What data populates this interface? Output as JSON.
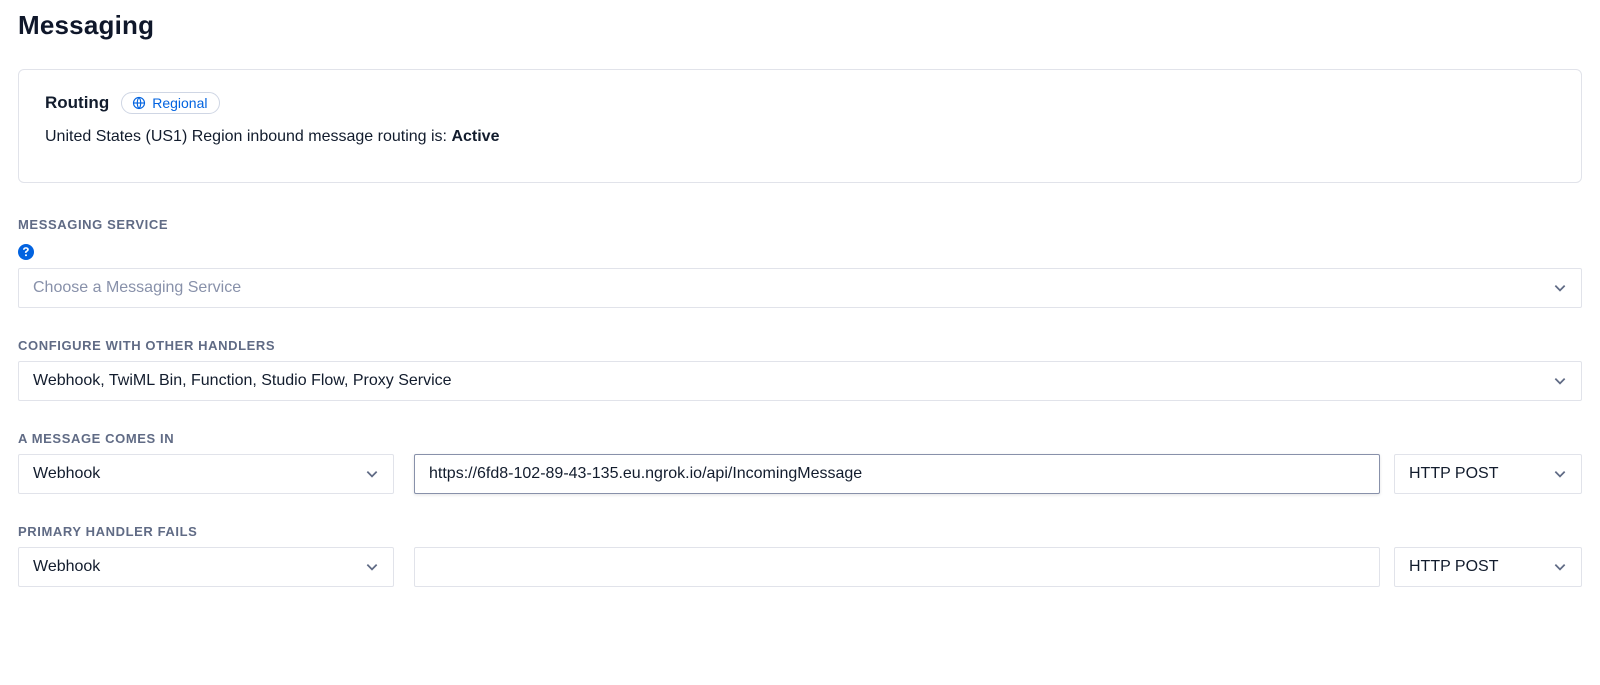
{
  "page": {
    "title": "Messaging"
  },
  "routing_card": {
    "title": "Routing",
    "badge_label": "Regional",
    "status_prefix": "United States (US1) Region inbound message routing is: ",
    "status_value": "Active"
  },
  "messaging_service": {
    "label": "MESSAGING SERVICE",
    "placeholder": "Choose a Messaging Service"
  },
  "configure_handlers": {
    "label": "CONFIGURE WITH OTHER HANDLERS",
    "value": "Webhook, TwiML Bin, Function, Studio Flow, Proxy Service"
  },
  "message_in": {
    "label": "A MESSAGE COMES IN",
    "handler_type": "Webhook",
    "url": "https://6fd8-102-89-43-135.eu.ngrok.io/api/IncomingMessage",
    "http_method": "HTTP POST"
  },
  "primary_fail": {
    "label": "PRIMARY HANDLER FAILS",
    "handler_type": "Webhook",
    "url": "",
    "http_method": "HTTP POST"
  }
}
